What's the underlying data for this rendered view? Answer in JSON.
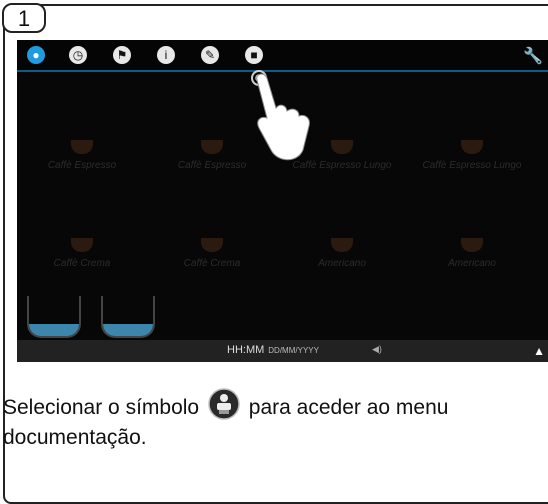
{
  "step": {
    "number": "1"
  },
  "toolbar": {
    "icons": [
      "water-drop-icon",
      "clock-icon",
      "flag-icon",
      "info-icon",
      "pencil-icon",
      "documentation-icon"
    ],
    "right_icon": "wrench-icon",
    "accent": "#1f9be0"
  },
  "products": [
    {
      "label": "Caffè Espresso"
    },
    {
      "label": "Caffè Espresso"
    },
    {
      "label": "Caffè Espresso Lungo"
    },
    {
      "label": "Caffè Espresso Lungo"
    },
    {
      "label": "Caffè Crema"
    },
    {
      "label": "Caffè Crema"
    },
    {
      "label": "Americano"
    },
    {
      "label": "Americano"
    }
  ],
  "statusbar": {
    "time": "HH:MM",
    "date": "DD/MM/YYYY"
  },
  "caption": {
    "before": "Selecionar o símbolo",
    "after": "para aceder ao menu",
    "line2": "documentação."
  }
}
